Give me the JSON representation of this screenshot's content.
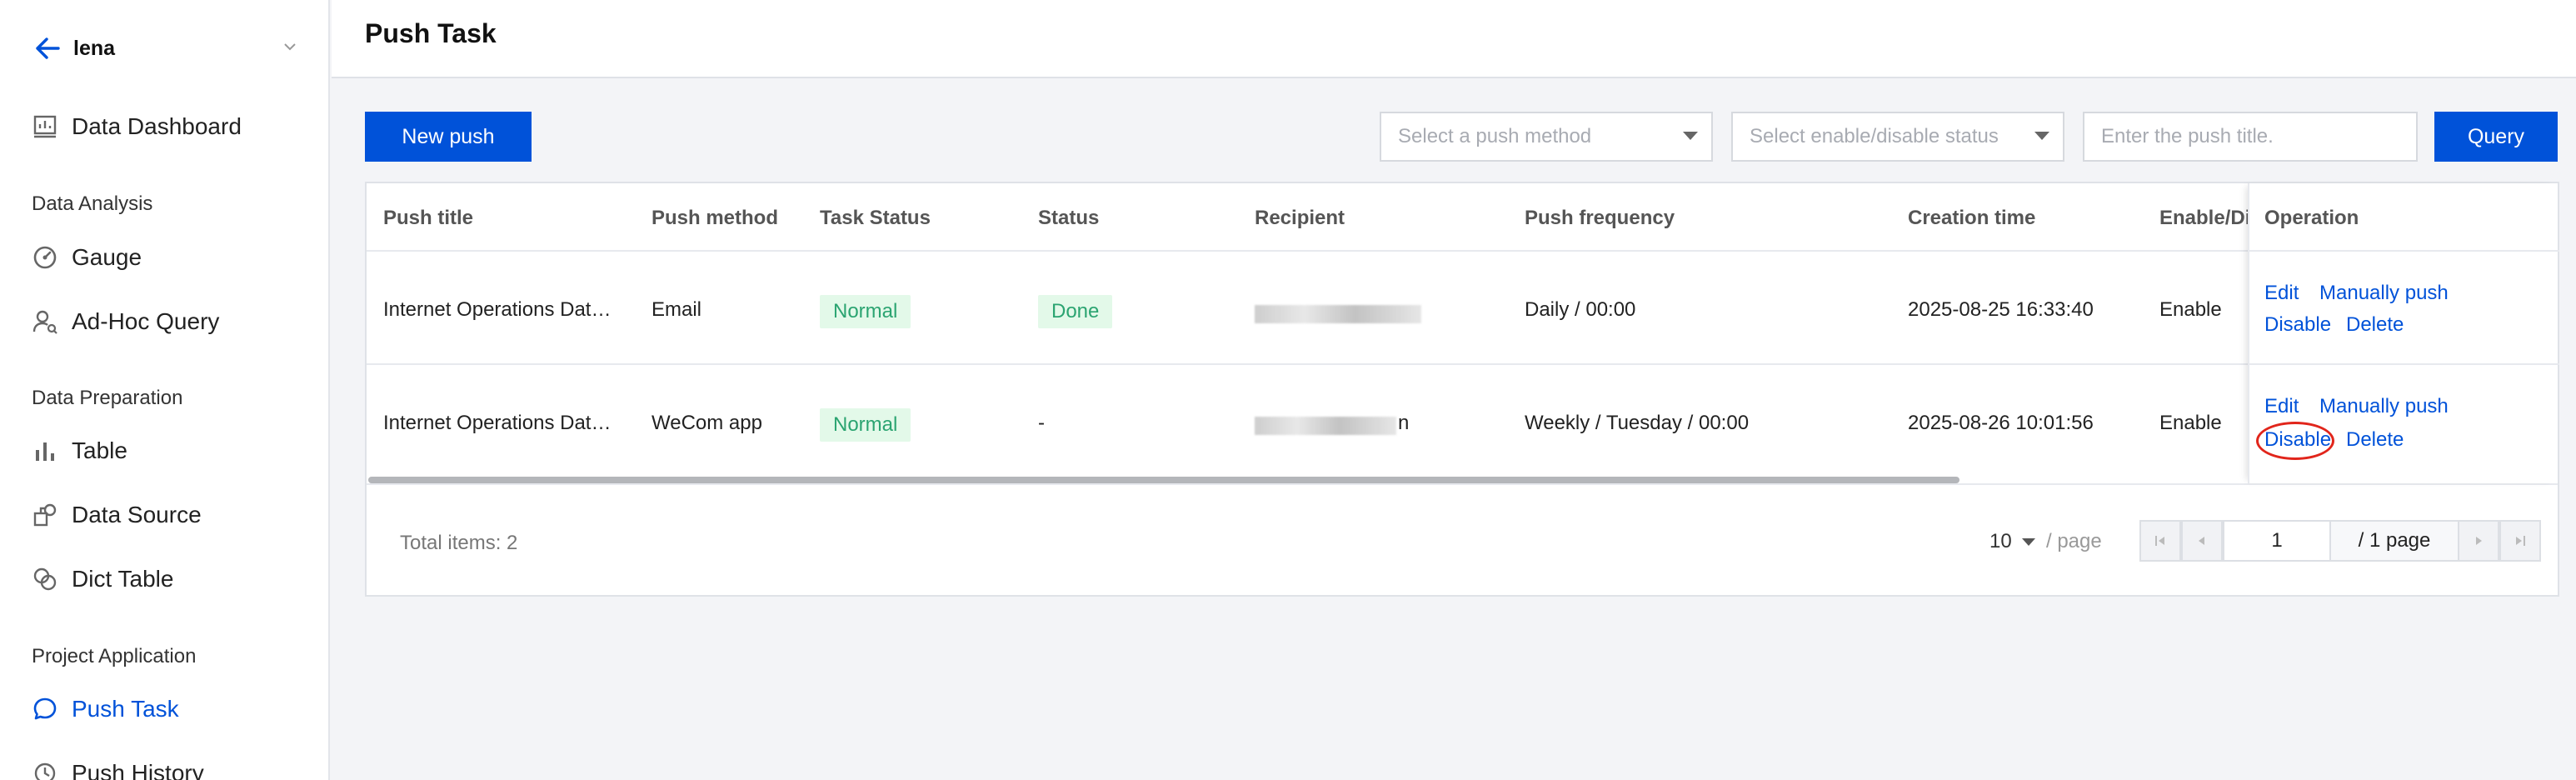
{
  "sidebar": {
    "project": "lena",
    "nav_top": [
      {
        "label": "Data Dashboard",
        "icon": "dashboard-icon"
      }
    ],
    "groups": [
      {
        "title": "Data Analysis",
        "items": [
          {
            "label": "Gauge",
            "icon": "gauge-icon"
          },
          {
            "label": "Ad-Hoc Query",
            "icon": "user-query-icon"
          }
        ]
      },
      {
        "title": "Data Preparation",
        "items": [
          {
            "label": "Table",
            "icon": "bar-chart-icon"
          },
          {
            "label": "Data Source",
            "icon": "data-source-icon"
          },
          {
            "label": "Dict Table",
            "icon": "dict-table-icon"
          }
        ]
      },
      {
        "title": "Project Application",
        "items": [
          {
            "label": "Push Task",
            "icon": "chat-bubble-icon",
            "active": true
          },
          {
            "label": "Push History",
            "icon": "history-icon"
          }
        ]
      }
    ]
  },
  "header": {
    "title": "Push Task"
  },
  "toolbar": {
    "new_push_label": "New push",
    "push_method_placeholder": "Select a push method",
    "status_placeholder": "Select enable/disable status",
    "title_placeholder": "Enter the push title.",
    "query_label": "Query"
  },
  "table": {
    "columns": [
      "Push title",
      "Push method",
      "Task Status",
      "Status",
      "Recipient",
      "Push frequency",
      "Creation time",
      "Enable/Dis",
      "Operation"
    ],
    "rows": [
      {
        "title": "Internet Operations Dat…",
        "method": "Email",
        "task_status": "Normal",
        "status": "Done",
        "recipient": "",
        "frequency": "Daily / 00:00",
        "created": "2025-08-25 16:33:40",
        "enable": "Enable",
        "ops": {
          "edit": "Edit",
          "manual": "Manually push",
          "disable": "Disable",
          "delete": "Delete"
        }
      },
      {
        "title": "Internet Operations Dat…",
        "method": "WeCom app",
        "task_status": "Normal",
        "status": "-",
        "recipient": "n",
        "frequency": "Weekly / Tuesday / 00:00",
        "created": "2025-08-26 10:01:56",
        "enable": "Enable",
        "ops": {
          "edit": "Edit",
          "manual": "Manually push",
          "disable": "Disable",
          "delete": "Delete"
        }
      }
    ]
  },
  "pagination": {
    "total_text": "Total items:  2",
    "page_size": "10",
    "per_page_label": "/ page",
    "current_page": "1",
    "total_pages_text": "/ 1 page"
  },
  "colors": {
    "accent": "#0052d9",
    "success_bg": "#e3f9e9",
    "success_fg": "#2ba471",
    "highlight": "#e1251b"
  }
}
